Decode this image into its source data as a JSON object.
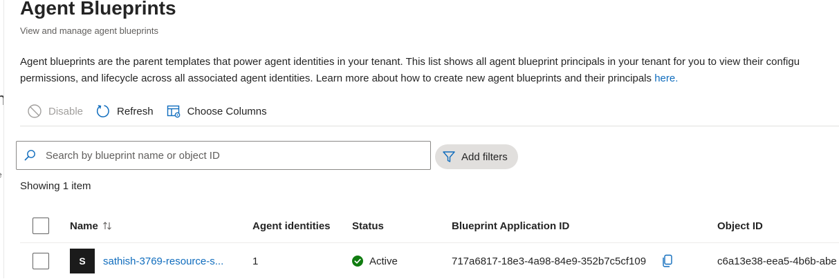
{
  "page": {
    "title": "Agent Blueprints",
    "subtitle": "View and manage agent blueprints"
  },
  "description": {
    "line1": "Agent blueprints are the parent templates that power agent identities in your tenant. This list shows all agent blueprint principals in your tenant for you to view their configu",
    "line2": "permissions, and lifecycle across all associated agent identities. Learn more about how to create new agent blueprints and their principals ",
    "link": "here."
  },
  "toolbar": {
    "disable_label": "Disable",
    "refresh_label": "Refresh",
    "columns_label": "Choose Columns"
  },
  "search": {
    "placeholder": "Search by blueprint name or object ID",
    "value": ""
  },
  "filters": {
    "add_label": "Add filters"
  },
  "results": {
    "count_text": "Showing 1 item"
  },
  "table": {
    "columns": {
      "name": "Name",
      "agent_identities": "Agent identities",
      "status": "Status",
      "app_id": "Blueprint Application ID",
      "object_id": "Object ID"
    },
    "rows": [
      {
        "avatar": "S",
        "name": "sathish-3769-resource-s...",
        "agent_identities": "1",
        "status": "Active",
        "app_id": "717a6817-18e3-4a98-84e9-352b7c5cf109",
        "object_id": "c6a13e38-eea5-4b6b-abe"
      }
    ]
  },
  "colors": {
    "link": "#0f6cbd",
    "status_active": "#107c10",
    "disabled_text": "#a19f9d"
  }
}
